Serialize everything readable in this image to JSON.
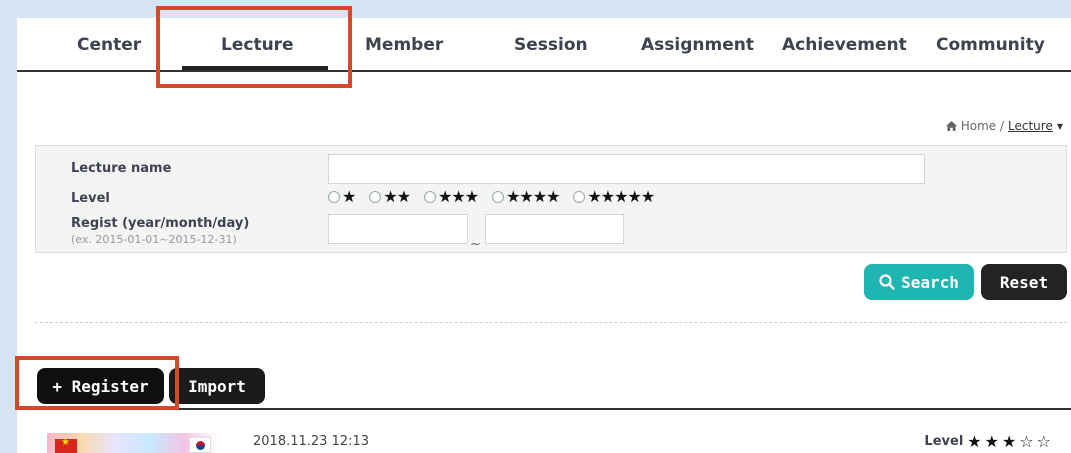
{
  "nav": {
    "items": [
      {
        "label": "Center"
      },
      {
        "label": "Lecture"
      },
      {
        "label": "Member"
      },
      {
        "label": "Session"
      },
      {
        "label": "Assignment"
      },
      {
        "label": "Achievement"
      },
      {
        "label": "Community"
      }
    ],
    "active": "Lecture"
  },
  "breadcrumb": {
    "home": "Home /",
    "current": "Lecture"
  },
  "search": {
    "lecture_name_label": "Lecture name",
    "lecture_name_value": "",
    "level_label": "Level",
    "level_options": [
      "★",
      "★★",
      "★★★",
      "★★★★",
      "★★★★★"
    ],
    "regist_label": "Regist (year/month/day)",
    "regist_hint": "(ex. 2015-01-01~2015-12-31)",
    "date_from": "",
    "date_to": "",
    "date_separator": "~",
    "search_button": "Search",
    "reset_button": "Reset"
  },
  "actions": {
    "register_button": "+ Register",
    "import_button": "Import"
  },
  "list": [
    {
      "date": "2018.11.23 12:13",
      "level_label": "Level",
      "level_stars": "★★★☆☆",
      "level_value": 3,
      "level_max": 5
    }
  ],
  "colors": {
    "accent_teal": "#1fb6b1",
    "dark_button": "#232323",
    "annotation_red": "#d9472b",
    "background": "#d8e4f3"
  }
}
